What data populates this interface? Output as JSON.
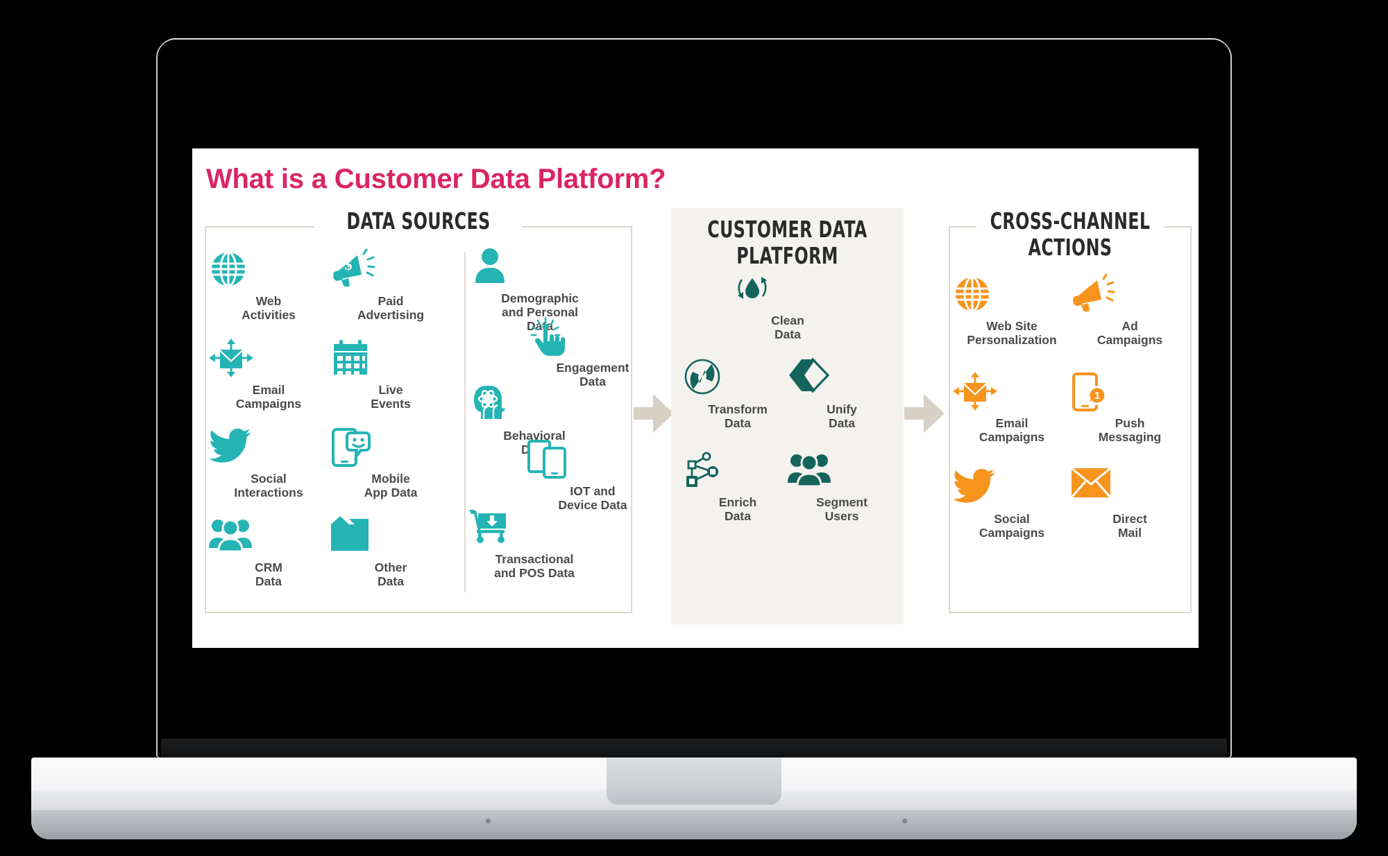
{
  "device": {
    "type": "laptop-mockup"
  },
  "slide": {
    "title": "What is a Customer Data Platform?",
    "title_color": "#da2465",
    "background": "#ffffff"
  },
  "colors": {
    "data_sources_accent": "#25b4b4",
    "cdp_accent": "#14645c",
    "actions_accent": "#f7941e",
    "panel_border": "#ddd7cd",
    "cdp_panel_background": "#f4f2ee",
    "arrow": "#d8d0c4",
    "label_text": "#4a4a4a",
    "heading_text": "#2b2b2b"
  },
  "panels": [
    {
      "id": "data-sources",
      "heading": "DATA SOURCES",
      "groups": [
        {
          "id": "sources-primary",
          "items": [
            {
              "label": "Web\nActivities",
              "icon": "globe-icon"
            },
            {
              "label": "Paid\nAdvertising",
              "icon": "megaphone-dollar-icon"
            },
            {
              "label": "Email\nCampaigns",
              "icon": "envelope-arrows-icon"
            },
            {
              "label": "Live\nEvents",
              "icon": "calendar-icon"
            },
            {
              "label": "Social\nInteractions",
              "icon": "twitter-bird-icon"
            },
            {
              "label": "Mobile\nApp Data",
              "icon": "mobile-chat-icon"
            },
            {
              "label": "CRM\nData",
              "icon": "people-group-icon"
            },
            {
              "label": "Other\nData",
              "icon": "folded-square-icon"
            }
          ]
        },
        {
          "id": "sources-secondary",
          "items": [
            {
              "label": "Demographic\nand Personal\nData",
              "icon": "person-icon"
            },
            {
              "label": "Engagement\nData",
              "icon": "tap-hand-icon"
            },
            {
              "label": "Behavioral\nData",
              "icon": "head-atom-icon"
            },
            {
              "label": "IOT and\nDevice Data",
              "icon": "devices-icon"
            },
            {
              "label": "Transactional\nand POS Data",
              "icon": "shopping-cart-icon"
            }
          ]
        }
      ]
    },
    {
      "id": "customer-data-platform",
      "heading": "CUSTOMER DATA\nPLATFORM",
      "items": [
        {
          "label": "Clean\nData",
          "icon": "droplet-refresh-icon"
        },
        {
          "label": "Transform\nData",
          "icon": "circle-arrows-icon"
        },
        {
          "label": "Unify\nData",
          "icon": "merge-diamond-icon"
        },
        {
          "label": "Enrich\nData",
          "icon": "network-nodes-icon"
        },
        {
          "label": "Segment\nUsers",
          "icon": "people-group-icon"
        }
      ]
    },
    {
      "id": "cross-channel-actions",
      "heading": "CROSS-CHANNEL\nACTIONS",
      "items": [
        {
          "label": "Web Site\nPersonalization",
          "icon": "globe-icon"
        },
        {
          "label": "Ad\nCampaigns",
          "icon": "megaphone-icon"
        },
        {
          "label": "Email\nCampaigns",
          "icon": "envelope-arrows-icon"
        },
        {
          "label": "Push\nMessaging",
          "icon": "mobile-notification-icon"
        },
        {
          "label": "Social\nCampaigns",
          "icon": "twitter-bird-icon"
        },
        {
          "label": "Direct\nMail",
          "icon": "envelope-icon"
        }
      ]
    }
  ],
  "connectors": [
    {
      "id": "sources-to-cdp",
      "icon": "right-arrow-icon"
    },
    {
      "id": "cdp-to-actions",
      "icon": "right-arrow-icon"
    }
  ]
}
